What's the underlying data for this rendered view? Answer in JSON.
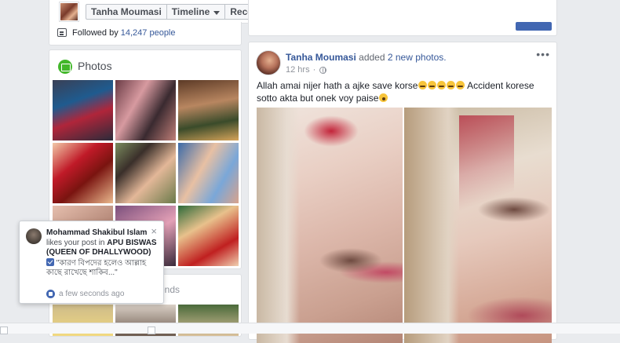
{
  "topbar": {
    "profile_name": "Tanha Moumasi",
    "timeline_label": "Timeline",
    "recent_label": "Recent"
  },
  "intro": {
    "followed_prefix": "Followed by ",
    "followed_count": "14,247 people"
  },
  "photos": {
    "title": "Photos"
  },
  "friends": {
    "title_fragment": "ends"
  },
  "post": {
    "author": "Tanha Moumasi",
    "action_prefix": "added",
    "action_link": "2 new photos.",
    "time": "12 hrs",
    "separator": "·",
    "text_part1": "Allah amai nijer hath a ajke save korse",
    "text_part2": " Accident korese sotto akta but onek voy paise",
    "more": "•••"
  },
  "notification": {
    "name": "Mohammad Shakibul Islam",
    "action": "likes your post in",
    "page": "APU BISWAS (QUEEN OF DHALLYWOOD)",
    "quote": "\"কারণ বিপদের হলেও আল্লাহ কাছে রাখেছে শাকিব...\"",
    "time": "a few seconds ago",
    "close": "×"
  },
  "colors": {
    "facebook_blue": "#4267b2",
    "link": "#365899",
    "background": "#e9ebee",
    "photos_green": "#42b72a"
  }
}
